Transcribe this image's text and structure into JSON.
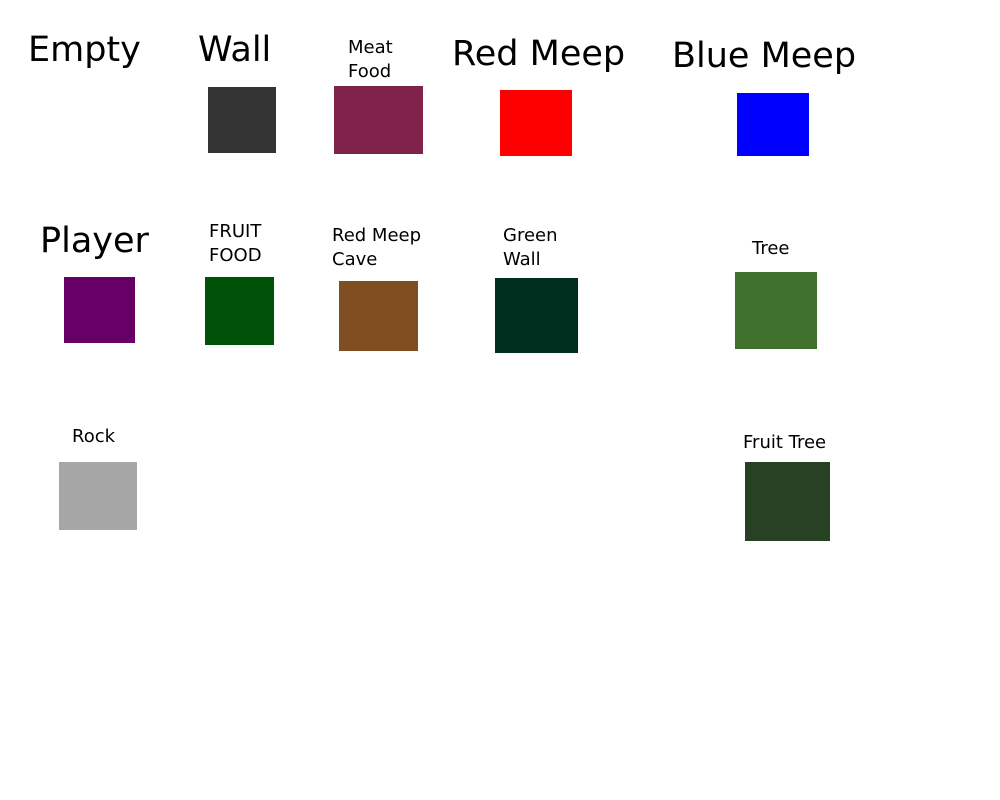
{
  "tiles": {
    "empty": {
      "label": "Empty",
      "color": "#ffffff"
    },
    "wall": {
      "label": "Wall",
      "color": "#333333"
    },
    "meat_food": {
      "label": "Meat\nFood",
      "color": "#81224b"
    },
    "red_meep": {
      "label": "Red Meep",
      "color": "#ff0000"
    },
    "blue_meep": {
      "label": "Blue Meep",
      "color": "#0000ff"
    },
    "player": {
      "label": "Player",
      "color": "#660066"
    },
    "fruit_food": {
      "label": "FRUIT\nFOOD",
      "color": "#005209"
    },
    "red_meep_cave": {
      "label": "Red Meep\nCave",
      "color": "#7f4f22"
    },
    "green_wall": {
      "label": "Green\nWall",
      "color": "#002f1f"
    },
    "tree": {
      "label": "Tree",
      "color": "#3f702d"
    },
    "rock": {
      "label": "Rock",
      "color": "#a6a6a6"
    },
    "fruit_tree": {
      "label": "Fruit Tree",
      "color": "#264222"
    }
  }
}
